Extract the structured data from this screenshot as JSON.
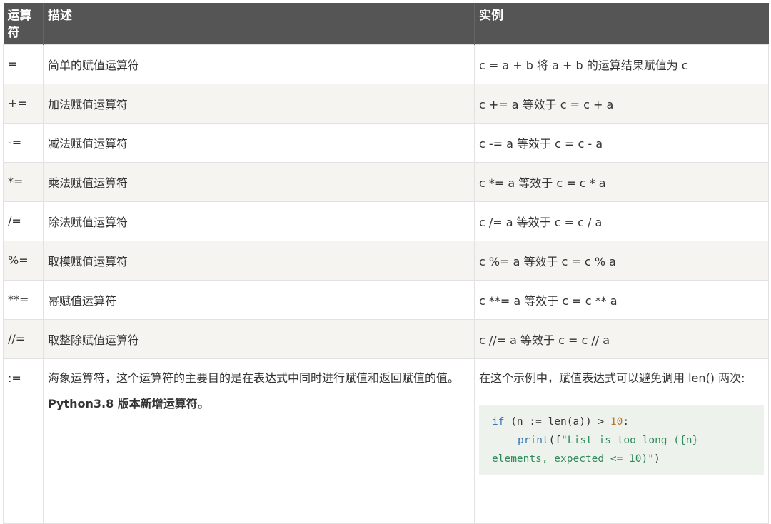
{
  "header": {
    "col_operator": "运算符",
    "col_desc": "描述",
    "col_example": "实例"
  },
  "rows": [
    {
      "op": "=",
      "desc": "简单的赋值运算符",
      "example": "c = a + b 将 a + b 的运算结果赋值为 c"
    },
    {
      "op": "+=",
      "desc": "加法赋值运算符",
      "example": "c += a 等效于 c = c + a"
    },
    {
      "op": "-=",
      "desc": "减法赋值运算符",
      "example": "c -= a 等效于 c = c - a"
    },
    {
      "op": "*=",
      "desc": "乘法赋值运算符",
      "example": "c *= a 等效于 c = c * a"
    },
    {
      "op": "/=",
      "desc": "除法赋值运算符",
      "example": "c /= a 等效于 c = c / a"
    },
    {
      "op": "%=",
      "desc": "取模赋值运算符",
      "example": "c %= a 等效于 c = c % a"
    },
    {
      "op": "**=",
      "desc": "幂赋值运算符",
      "example": "c **= a 等效于 c = c ** a"
    },
    {
      "op": "//=",
      "desc": "取整除赋值运算符",
      "example": "c //= a 等效于 c = c // a"
    }
  ],
  "walrus": {
    "op": ":=",
    "desc": "海象运算符，这个运算符的主要目的是在表达式中同时进行赋值和返回赋值的值。",
    "desc_bold": "Python3.8 版本新增运算符。",
    "example_text": "在这个示例中，赋值表达式可以避免调用 len() 两次:",
    "code": {
      "kw_if": "if",
      "part1": " (n := len(a)) > ",
      "num": "10",
      "part2": ":",
      "kw_print": "print",
      "part3": "(f",
      "str": "\"List is too long ({n} elements, expected <= 10)\"",
      "part4": ")"
    }
  }
}
